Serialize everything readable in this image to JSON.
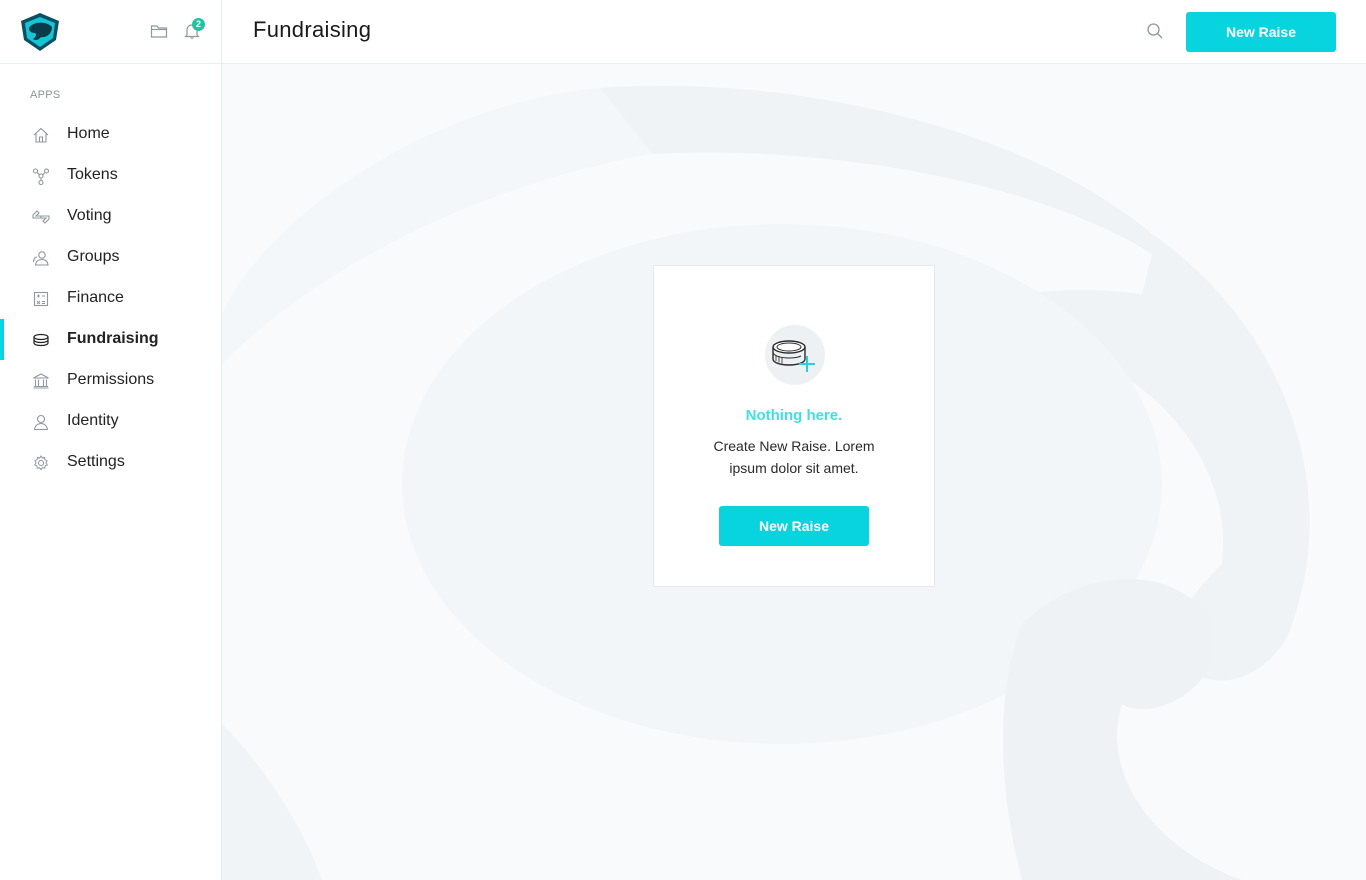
{
  "header": {
    "title": "Fundraising",
    "new_raise_label": "New Raise"
  },
  "notifications": {
    "count": "2"
  },
  "sidebar": {
    "section_label": "APPS",
    "items": [
      {
        "label": "Home",
        "icon": "home-icon"
      },
      {
        "label": "Tokens",
        "icon": "tokens-icon"
      },
      {
        "label": "Voting",
        "icon": "voting-icon"
      },
      {
        "label": "Groups",
        "icon": "groups-icon"
      },
      {
        "label": "Finance",
        "icon": "finance-icon"
      },
      {
        "label": "Fundraising",
        "icon": "coins-icon",
        "active": true
      },
      {
        "label": "Permissions",
        "icon": "bank-icon"
      },
      {
        "label": "Identity",
        "icon": "user-icon"
      },
      {
        "label": "Settings",
        "icon": "gear-icon"
      }
    ]
  },
  "empty_state": {
    "title": "Nothing here.",
    "text": "Create New Raise. Lorem ipsum dolor sit amet.",
    "button_label": "New Raise",
    "icon": "coins-add-icon"
  },
  "colors": {
    "accent": "#08d4df",
    "empty_title": "#3fe0e3",
    "badge": "#21c3a1"
  }
}
